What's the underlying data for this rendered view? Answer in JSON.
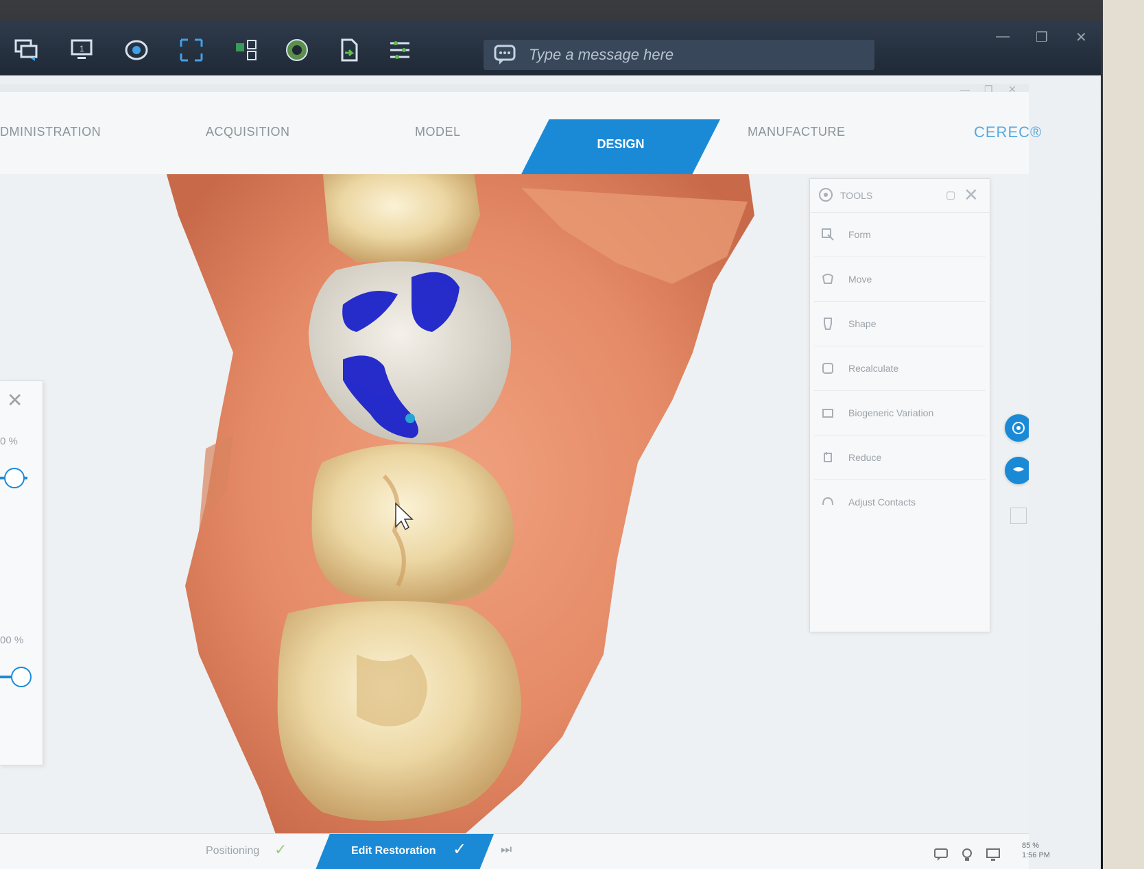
{
  "remote_toolbar": {
    "icons": [
      "remote-monitor-icon",
      "display-icon",
      "eye-icon",
      "fullscreen-icon",
      "switch-sides-icon",
      "record-icon",
      "file-transfer-icon",
      "settings-icon"
    ],
    "message_placeholder": "Type a message here"
  },
  "phases": {
    "items": [
      {
        "label": "DMINISTRATION"
      },
      {
        "label": "ACQUISITION"
      },
      {
        "label": "MODEL"
      },
      {
        "label": "DESIGN",
        "active": true
      },
      {
        "label": "MANUFACTURE"
      }
    ],
    "brand": "CEREC®",
    "active_color": "#1b8ad6"
  },
  "left_panel": {
    "close": "✕",
    "value1": "0 %",
    "value2": "00 %"
  },
  "tools": {
    "title": "TOOLS",
    "items": [
      {
        "label": "Form",
        "icon": "form-icon"
      },
      {
        "label": "Move",
        "icon": "move-icon"
      },
      {
        "label": "Shape",
        "icon": "shape-icon"
      },
      {
        "label": "Recalculate",
        "icon": "recalculate-icon"
      },
      {
        "label": "Biogeneric Variation",
        "icon": "biogeneric-icon"
      },
      {
        "label": "Reduce",
        "icon": "reduce-icon"
      },
      {
        "label": "Adjust Contacts",
        "icon": "contacts-icon"
      }
    ]
  },
  "steps": {
    "previous": "Positioning",
    "active": "Edit Restoration"
  },
  "tray": {
    "zoom": "85 %",
    "time": "1:56 PM"
  }
}
